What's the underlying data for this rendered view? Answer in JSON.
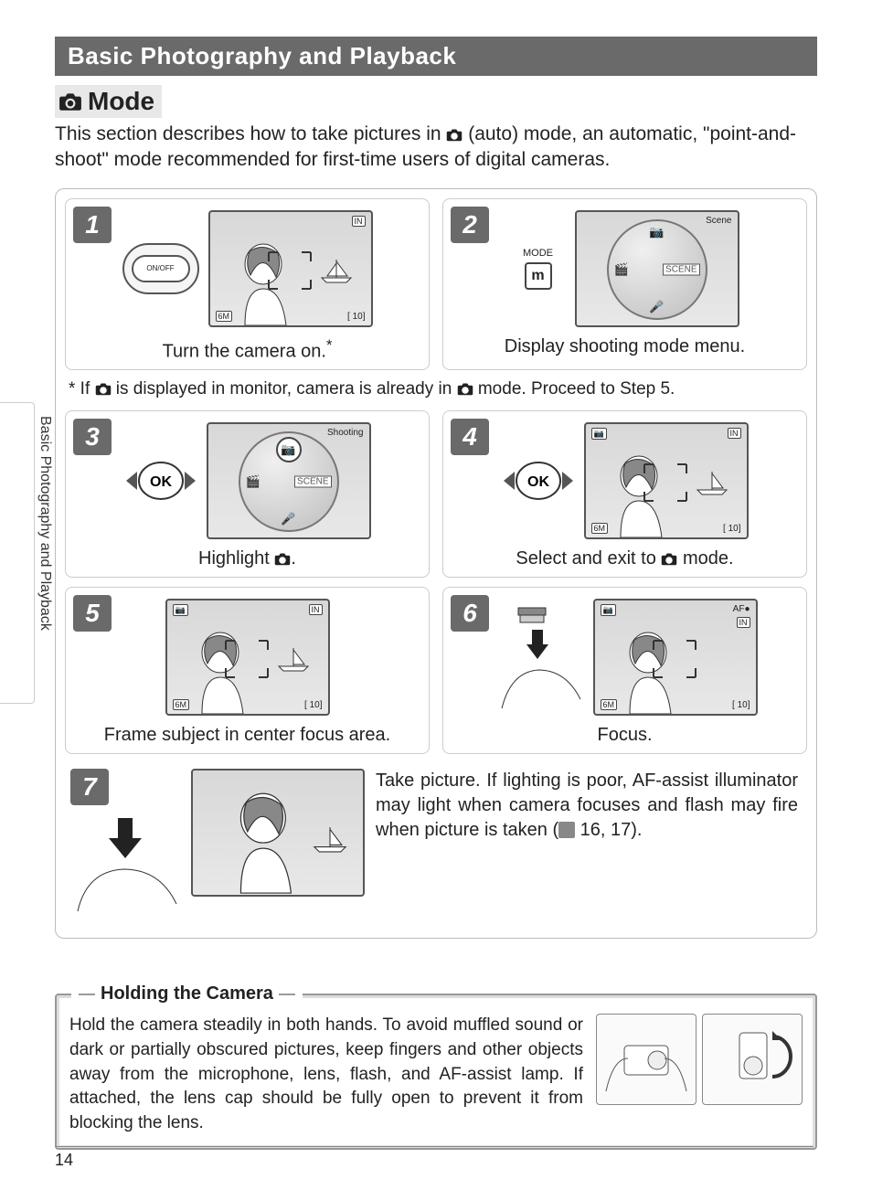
{
  "page_number": "14",
  "side_tab": "Basic Photography and Playback",
  "section_bar": "Basic Photography and Playback",
  "mode_heading": "Mode",
  "intro_part1": "This section describes how to take pictures in ",
  "intro_part2": " (auto) mode, an automatic, \"point-and-shoot\" mode recommended for first-time users of digital cameras.",
  "footnote_part1": "* If ",
  "footnote_part2": " is displayed in monitor, camera is already in ",
  "footnote_part3": " mode.  Proceed to Step 5.",
  "onoff_label": "ON/OFF",
  "mode_btn_label": "MODE",
  "mode_btn_m": "m",
  "dial_scene": "SCENE",
  "dial_top_cam": "📷",
  "lcd": {
    "bl_6m": "6M",
    "br_10": "[   10]",
    "tr_in": "IN",
    "scene_label": "Scene",
    "shooting_label": "Shooting",
    "af_indicator": "AF●"
  },
  "steps": {
    "s1": {
      "num": "1",
      "caption": "Turn the camera on.",
      "asterisk": "*"
    },
    "s2": {
      "num": "2",
      "caption": "Display shooting mode menu."
    },
    "s3": {
      "num": "3",
      "caption_pre": "Highlight ",
      "caption_post": "."
    },
    "s4": {
      "num": "4",
      "caption_pre": "Select and exit to ",
      "caption_post": " mode."
    },
    "s5": {
      "num": "5",
      "caption": "Frame subject in center focus area."
    },
    "s6": {
      "num": "6",
      "caption": "Focus."
    },
    "s7": {
      "num": "7",
      "text_pre": "Take picture.  If lighting is poor, AF-assist illuminator may light when camera focuses and flash may fire when picture is taken (",
      "text_post": " 16, 17)."
    }
  },
  "ok_label": "OK",
  "holding": {
    "title": "Holding the Camera",
    "text": "Hold the camera steadily in both hands.  To avoid muffled sound or dark or partially obscured pictures, keep fingers and other objects away from the microphone, lens, flash, and AF-assist lamp.  If attached, the lens cap should be fully open to prevent it from blocking the lens."
  }
}
